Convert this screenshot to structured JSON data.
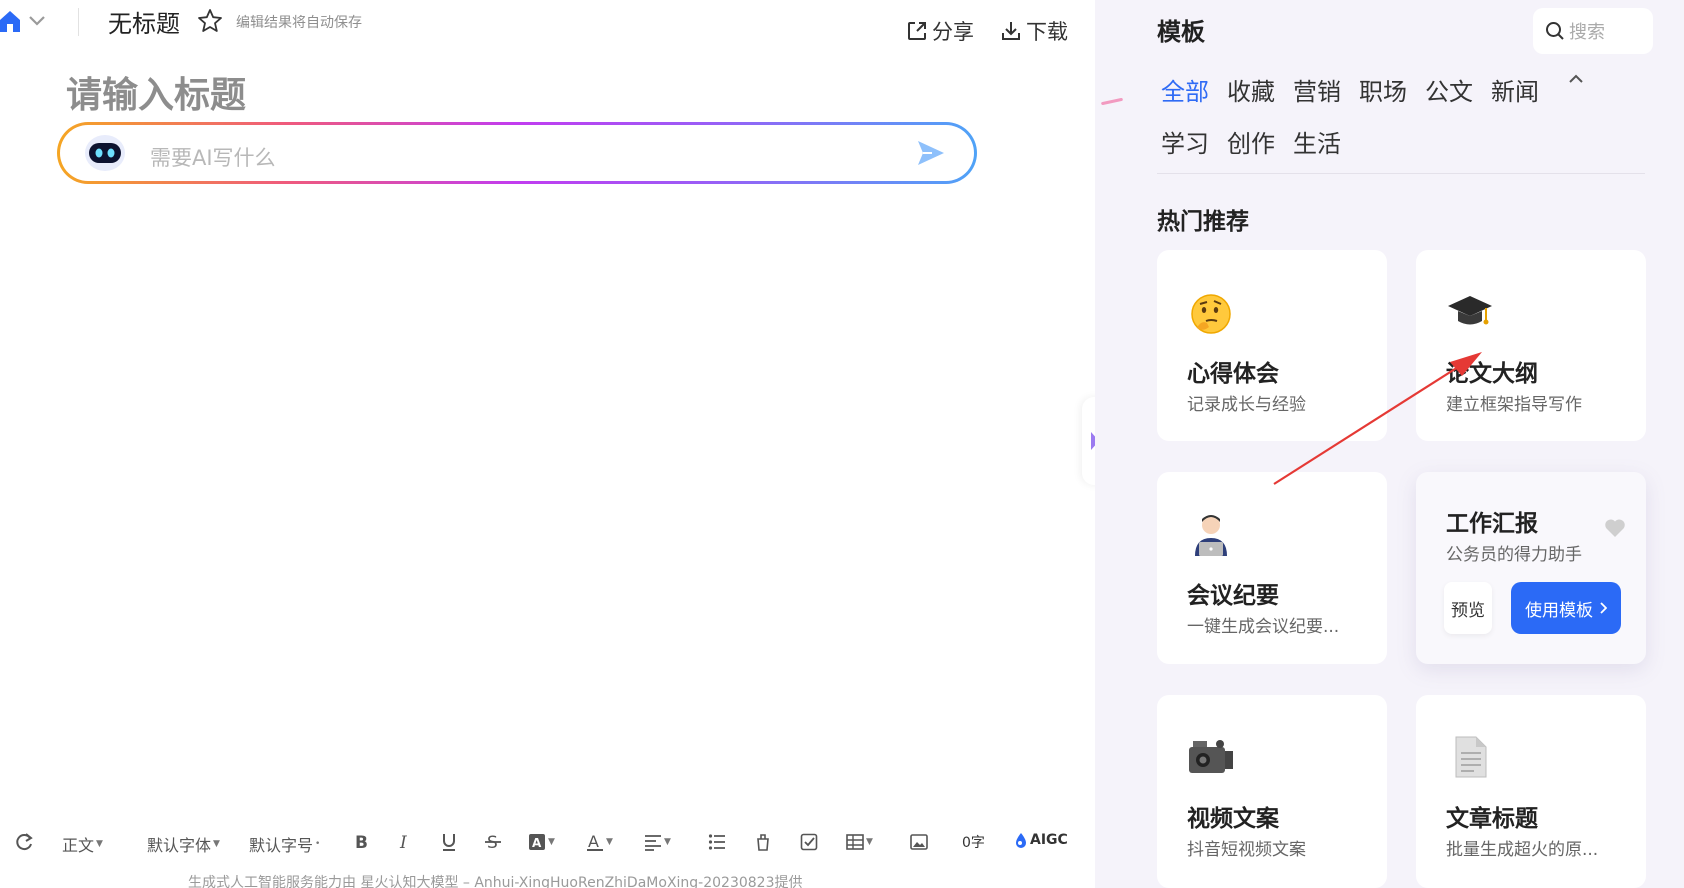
{
  "topbar": {
    "doc_name": "无标题",
    "autosave_text": "编辑结果将自动保存",
    "share_label": "分享",
    "download_label": "下载"
  },
  "editor": {
    "title_placeholder": "请输入标题",
    "ai_placeholder": "需要AI写什么"
  },
  "toolbar": {
    "paragraph_style": "正文",
    "font_family": "默认字体",
    "font_size": "默认字号",
    "word_count": "0字",
    "aigc_label": "AIGC"
  },
  "footer_note": "生成式人工智能服务能力由 星火认知大模型 – Anhui-XingHuoRenZhiDaMoXing-20230823提供",
  "panel": {
    "title": "模板",
    "search_placeholder": "搜索",
    "categories": [
      "全部",
      "收藏",
      "营销",
      "职场",
      "公文",
      "新闻",
      "学习",
      "创作",
      "生活"
    ],
    "active_category": "全部",
    "section_title": "热门推荐",
    "cards": [
      {
        "title": "心得体会",
        "desc": "记录成长与经验",
        "icon": "thinking-face-icon"
      },
      {
        "title": "论文大纲",
        "desc": "建立框架指导写作",
        "icon": "graduation-cap-icon"
      },
      {
        "title": "会议纪要",
        "desc": "一键生成会议纪要...",
        "icon": "technologist-icon"
      },
      {
        "title": "工作汇报",
        "desc": "公务员的得力助手",
        "icon": "heart-icon",
        "preview_label": "预览",
        "use_label": "使用模板"
      },
      {
        "title": "视频文案",
        "desc": "抖音短视频文案",
        "icon": "video-camera-icon"
      },
      {
        "title": "文章标题",
        "desc": "批量生成超火的原...",
        "icon": "document-icon"
      }
    ]
  },
  "colors": {
    "accent": "#2b6af6",
    "panel_bg": "#f5f3fa",
    "annotation": "#e53935"
  }
}
